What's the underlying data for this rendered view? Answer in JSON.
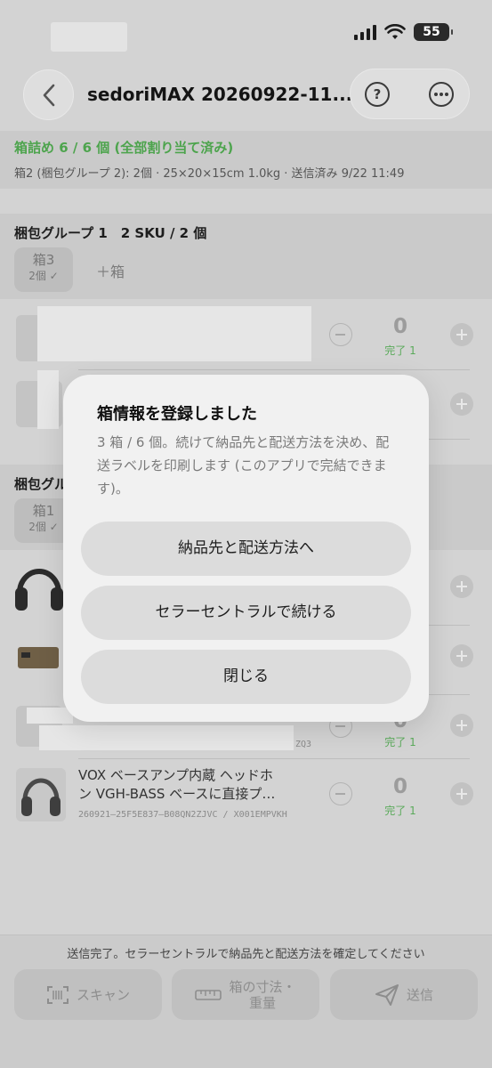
{
  "status_bar": {
    "battery": "55"
  },
  "header": {
    "title": "sedoriMAX 20260922-11..."
  },
  "summary": {
    "packing": "箱詰め 6 / 6 個 (全部割り当て済み)",
    "detail": "箱2 (梱包グループ 2): 2個 · 25×20×15cm 1.0kg · 送信済み 9/22 11:49"
  },
  "group1": {
    "title": "梱包グループ 1　2 SKU / 2 個",
    "box_chip": {
      "label": "箱3",
      "count": "2個 ✓"
    },
    "add_box": "＋箱",
    "item1": {
      "qty": "0",
      "done": "完了 1"
    }
  },
  "group2": {
    "title": "梱包グル",
    "box_chip": {
      "label": "箱1",
      "count": "2個 ✓"
    },
    "item3": {
      "sku_tail": "ZQ3",
      "qty": "0",
      "done": "完了 1"
    },
    "item4": {
      "name_line1": "VOX ベースアンプ内蔵 ヘッドホ",
      "name_line2": "ン VGH-BASS ベースに直接プ…",
      "sku": "260921–25F5E837–B08QN2ZJVC / X001EMPVKH",
      "qty": "0",
      "done": "完了 1"
    }
  },
  "bottom": {
    "status": "送信完了。セラーセントラルで納品先と配送方法を確定してください",
    "scan": "スキャン",
    "dims_line1": "箱の寸法・",
    "dims_line2": "重量",
    "send": "送信"
  },
  "modal": {
    "title": "箱情報を登録しました",
    "message": "3 箱 / 6 個。続けて納品先と配送方法を決め、配送ラベルを印刷します (このアプリで完結できます)。",
    "btn_primary": "納品先と配送方法へ",
    "btn_secondary": "セラーセントラルで続ける",
    "btn_close": "閉じる"
  }
}
